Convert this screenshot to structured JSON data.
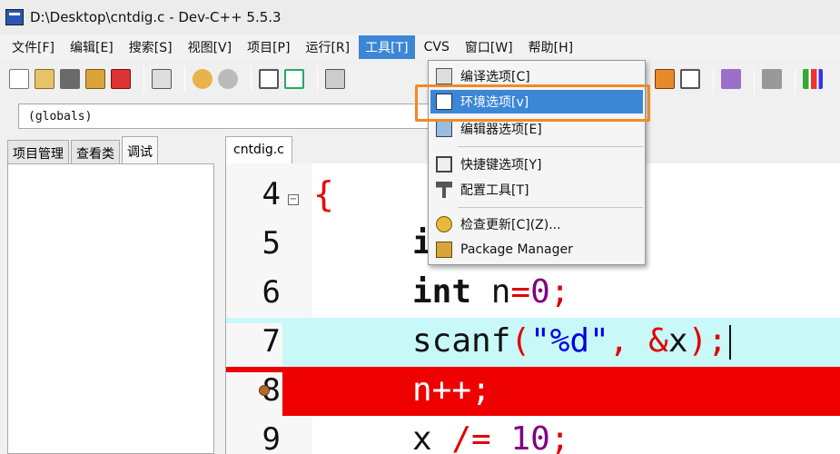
{
  "window": {
    "title": "D:\\Desktop\\cntdig.c - Dev-C++ 5.5.3"
  },
  "menubar": [
    {
      "label": "文件[F]",
      "active": false
    },
    {
      "label": "编辑[E]",
      "active": false
    },
    {
      "label": "搜索[S]",
      "active": false
    },
    {
      "label": "视图[V]",
      "active": false
    },
    {
      "label": "项目[P]",
      "active": false
    },
    {
      "label": "运行[R]",
      "active": false
    },
    {
      "label": "工具[T]",
      "active": true
    },
    {
      "label": "CVS",
      "active": false
    },
    {
      "label": "窗口[W]",
      "active": false
    },
    {
      "label": "帮助[H]",
      "active": false
    }
  ],
  "scope": {
    "value": "(globals)"
  },
  "left_tabs": [
    "项目管理",
    "查看类",
    "调试"
  ],
  "editor_tab": "cntdig.c",
  "tools_menu": {
    "items": [
      {
        "label": "编译选项[C]",
        "icon": "compile-options-icon"
      },
      {
        "label": "环境选项[v]",
        "icon": "environment-options-icon"
      },
      {
        "label": "编辑器选项[E]",
        "icon": "editor-options-icon"
      },
      {
        "label": "快捷键选项[Y]",
        "icon": "shortcut-options-icon"
      },
      {
        "label": "配置工具[T]",
        "icon": "configure-tools-icon"
      },
      {
        "label": "检查更新[C](Z)...",
        "icon": "check-updates-icon"
      },
      {
        "label": "Package Manager",
        "icon": "package-manager-icon"
      }
    ]
  },
  "code": {
    "lines": [
      {
        "no": "4",
        "text": "{"
      },
      {
        "no": "5",
        "text": "i"
      },
      {
        "no": "6",
        "text": "int n=0;"
      },
      {
        "no": "7",
        "text": "scanf(\"%d\", &x);"
      },
      {
        "no": "8",
        "text": "n++;"
      },
      {
        "no": "9",
        "text": "x /= 10;"
      }
    ]
  },
  "colors": {
    "menu_highlight": "#3c86d6",
    "current_line": "#c8f8f8",
    "breakpoint_line": "#ee0000",
    "annotation_box": "#f08a24"
  }
}
